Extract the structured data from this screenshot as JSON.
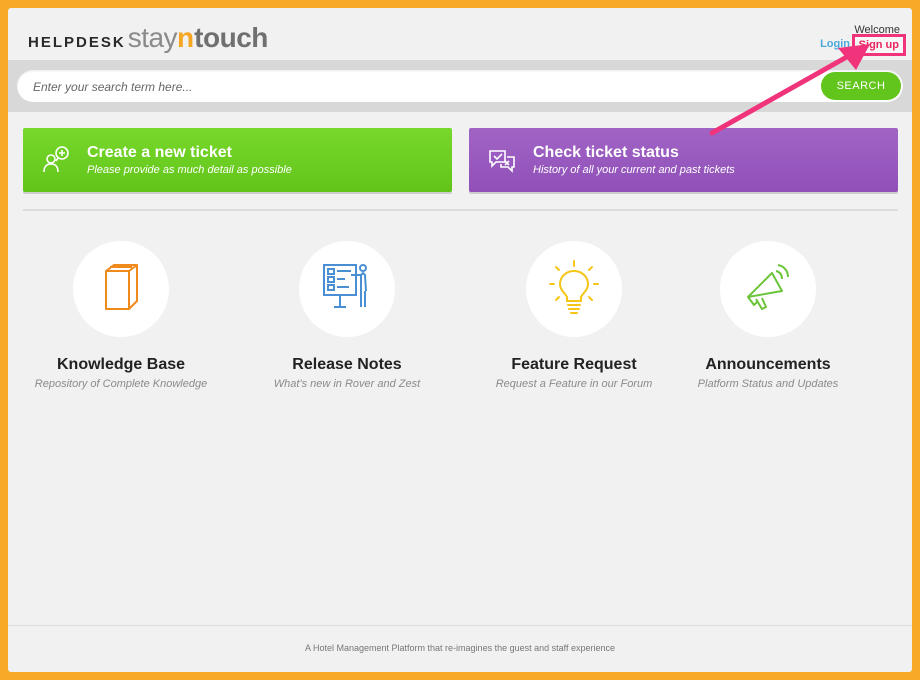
{
  "header": {
    "logo_helpdesk": "HELPDESK",
    "logo_stay": "stay",
    "logo_n": "n",
    "logo_touch": "touch",
    "welcome": "Welcome",
    "login": "Login",
    "signup": "Sign up"
  },
  "search": {
    "placeholder": "Enter your search term here...",
    "button": "SEARCH"
  },
  "actions": [
    {
      "title": "Create a new ticket",
      "subtitle": "Please provide as much detail as possible",
      "color": "#6fd123",
      "icon": "create-ticket-icon"
    },
    {
      "title": "Check ticket status",
      "subtitle": "History of all your current and past tickets",
      "color": "#9b5bbf",
      "icon": "ticket-status-icon"
    }
  ],
  "categories": [
    {
      "title": "Knowledge Base",
      "subtitle": "Repository of Complete Knowledge",
      "icon": "book-icon",
      "color": "#f08a1c"
    },
    {
      "title": "Release Notes",
      "subtitle": "What's new in Rover and Zest",
      "icon": "presentation-icon",
      "color": "#4a8fd4"
    },
    {
      "title": "Feature Request",
      "subtitle": "Request a Feature in our Forum",
      "icon": "lightbulb-icon",
      "color": "#f5c518"
    },
    {
      "title": "Announcements",
      "subtitle": "Platform Status and Updates",
      "icon": "megaphone-icon",
      "color": "#6bc43a"
    }
  ],
  "footer": {
    "text": "A Hotel Management Platform that re-imagines the guest and staff experience"
  },
  "colors": {
    "accent_orange": "#f7a928",
    "highlight_pink": "#f0337a"
  }
}
